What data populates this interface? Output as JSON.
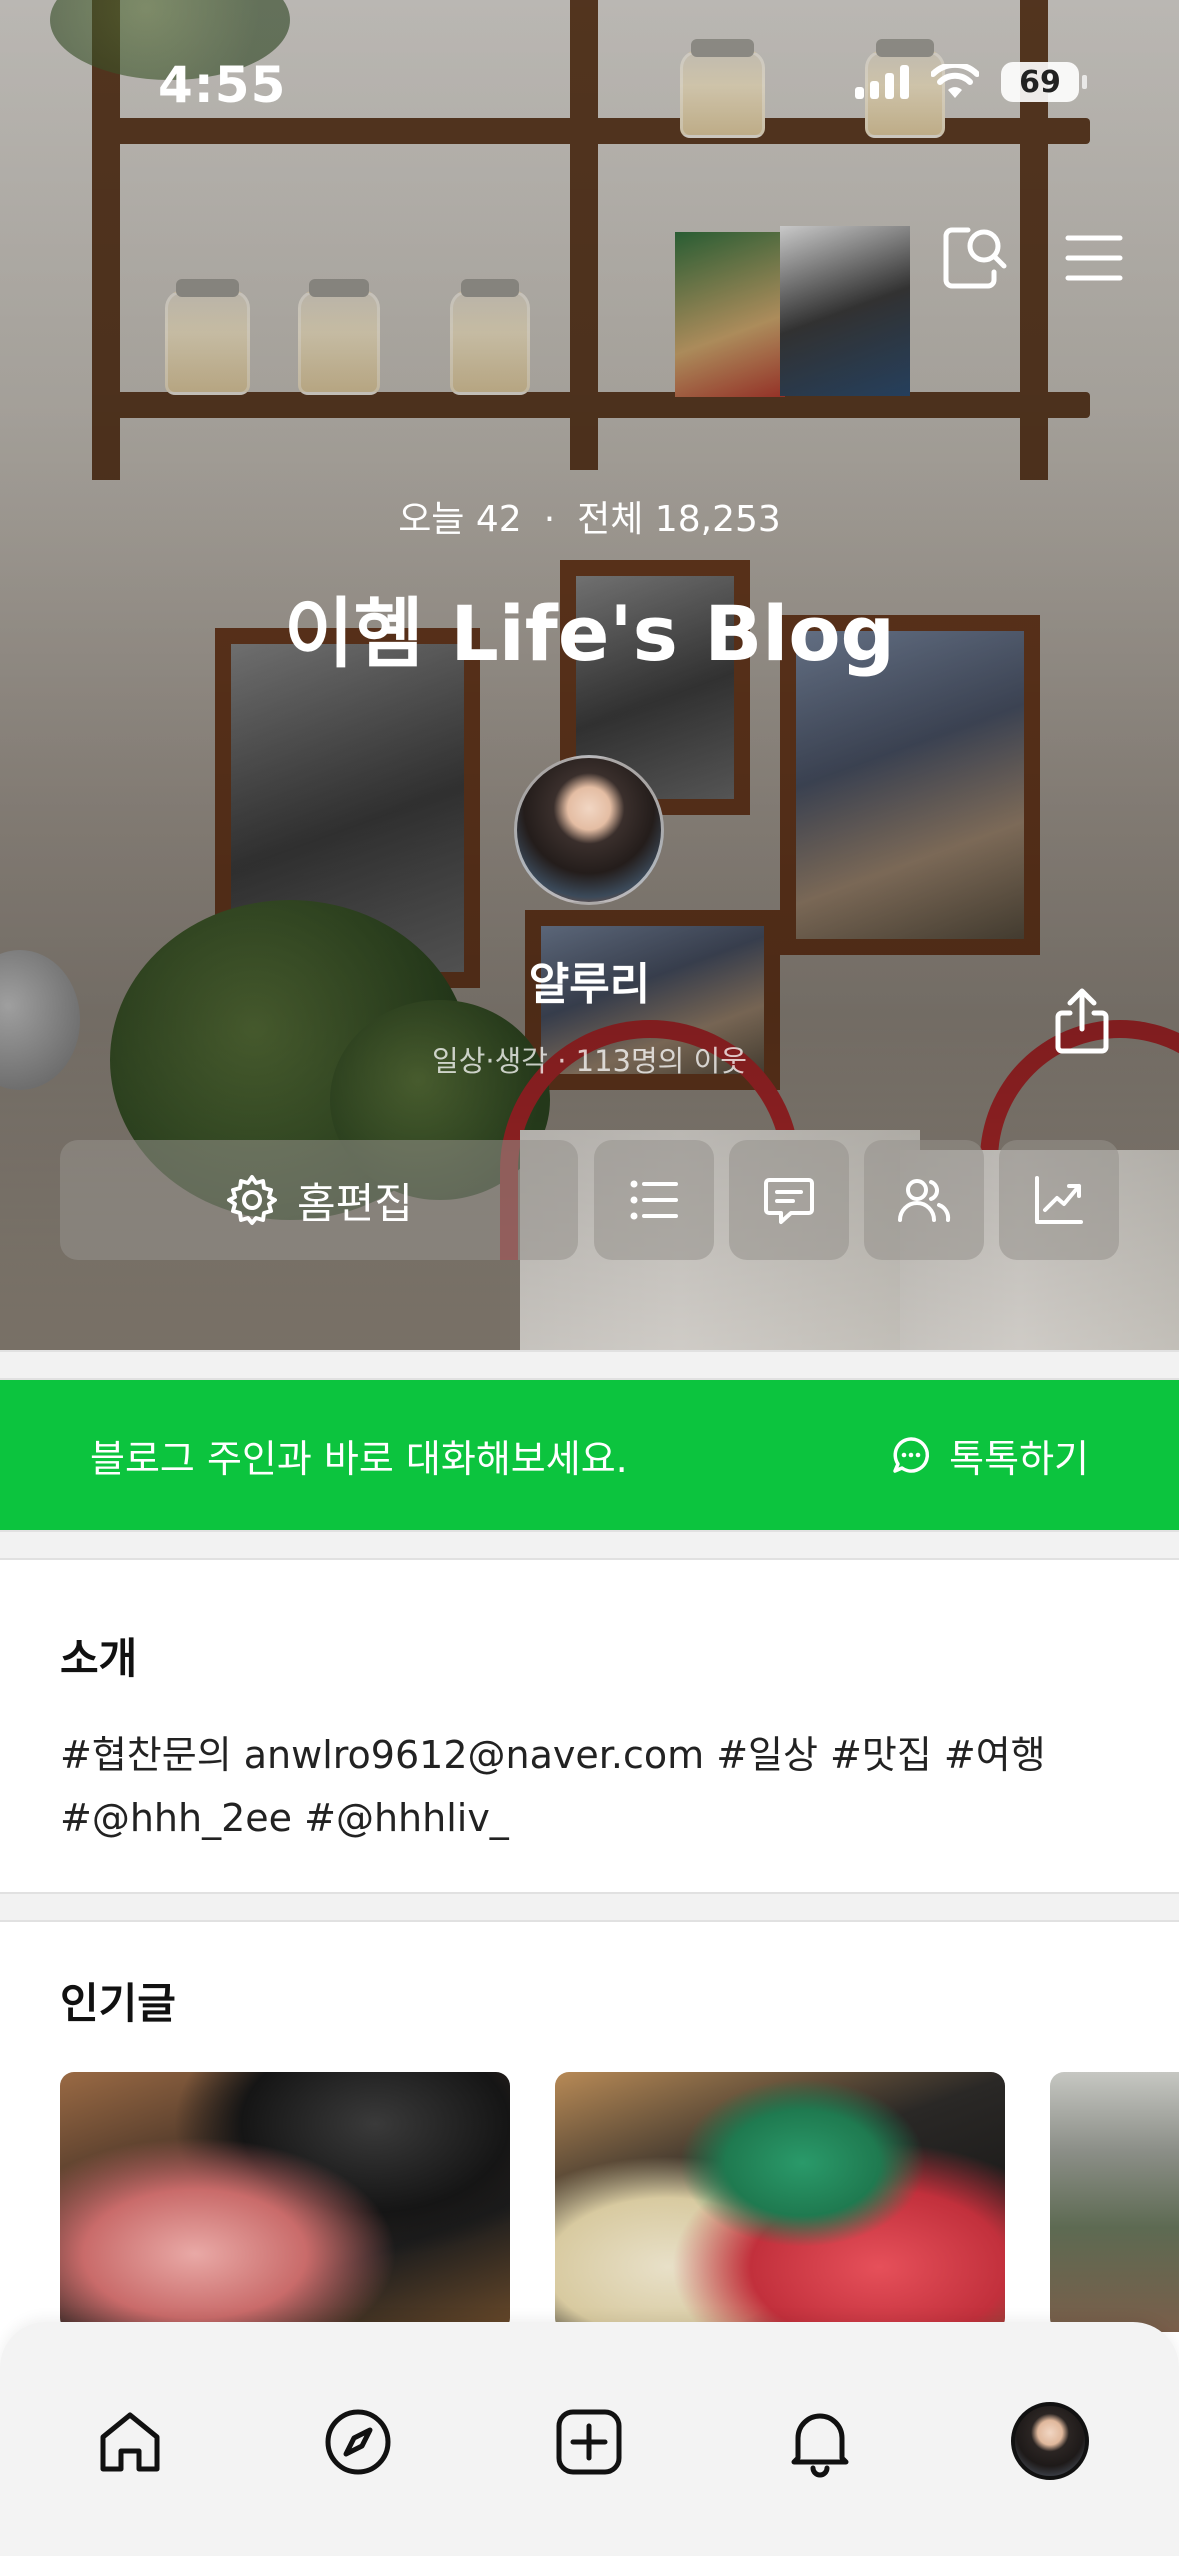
{
  "status_bar": {
    "time": "4:55",
    "battery": "69"
  },
  "header": {
    "today_label": "오늘 42",
    "separator": "·",
    "total_label": "전체 18,253",
    "blog_title": "이혬 Life's Blog",
    "nickname": "얄루리",
    "subline": "일상·생각 · 113명의 이웃"
  },
  "actions": {
    "home_edit_label": "홈편집"
  },
  "talk_banner": {
    "message": "블로그 주인과 바로 대화해보세요.",
    "button_label": "톡톡하기"
  },
  "intro": {
    "title": "소개",
    "line1": "#협찬문의 anwlro9612@naver.com  #일상 #맛집 #여행",
    "line2": "#@hhh_2ee  #@hhhliv_"
  },
  "popular": {
    "title": "인기글"
  },
  "colors": {
    "accent_green": "#0cc43e",
    "tab_bar_bg": "#f3f3f3"
  },
  "icons": {
    "top": [
      "search-icon",
      "menu-icon"
    ],
    "hero": [
      "share-icon"
    ],
    "actions": [
      "gear-icon",
      "list-icon",
      "comment-icon",
      "neighbors-icon",
      "stats-icon"
    ],
    "tabs": [
      "home-icon",
      "compass-icon",
      "add-post-icon",
      "bell-icon",
      "profile-avatar"
    ]
  }
}
